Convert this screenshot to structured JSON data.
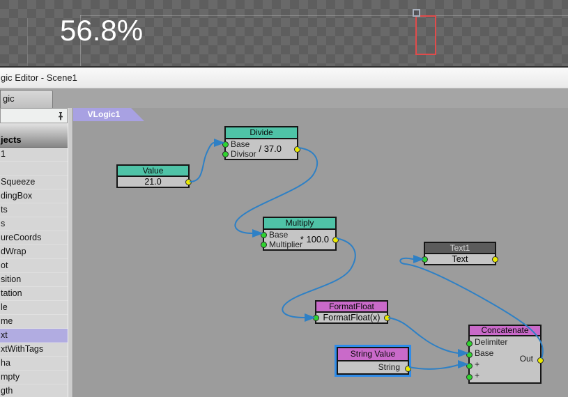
{
  "overlay": {
    "percentage": "56.8%",
    "marquee_color": "#e14b4b"
  },
  "window": {
    "title": "gic Editor - Scene1"
  },
  "doc_tabs": {
    "tabs": [
      {
        "label": "gic"
      }
    ]
  },
  "sidebar": {
    "pin_icon": "pin-icon",
    "header": "jects",
    "items": [
      "1",
      "",
      "Squeeze",
      "dingBox",
      "ts",
      "s",
      "ureCoords",
      "dWrap",
      "ot",
      "sition",
      "tation",
      "le",
      "me",
      "xt",
      "xtWithTags",
      "ha",
      "mpty",
      "gth"
    ],
    "selected_item": "xt",
    "selected_index": 13,
    "selected_color": "#b1ace1"
  },
  "canvas": {
    "tab": "VLogic1",
    "nodes": {
      "value": {
        "title": "Value",
        "value": "21.0"
      },
      "divide": {
        "title": "Divide",
        "inputs": [
          "Base",
          "Divisor"
        ],
        "value": "/ 37.0"
      },
      "multiply": {
        "title": "Multiply",
        "inputs": [
          "Base",
          "Multiplier"
        ],
        "value": "* 100.0"
      },
      "text1": {
        "title": "Text1",
        "row": "Text"
      },
      "formatfloat": {
        "title": "FormatFloat",
        "row": "FormatFloat(x)"
      },
      "stringvalue": {
        "title": "String Value",
        "output": "String",
        "selected": true
      },
      "concatenate": {
        "title": "Concatenate",
        "inputs": [
          "Delimiter",
          "Base",
          "+",
          "+"
        ],
        "output": "Out"
      }
    },
    "wires": [
      {
        "from": "Value.out",
        "to": "Divide.Base"
      },
      {
        "from": "Divide.out",
        "to": "Multiply.Base"
      },
      {
        "from": "Multiply.out",
        "to": "FormatFloat.in"
      },
      {
        "from": "FormatFloat.out",
        "to": "Concatenate.Base"
      },
      {
        "from": "String Value.String",
        "to": "Concatenate.+"
      },
      {
        "from": "Concatenate.Out",
        "to": "Text1.Text"
      }
    ]
  },
  "colors": {
    "canvas_bg": "#9c9c9c",
    "node_body": "#c5c5c5",
    "header_teal": "#4fc3a7",
    "header_magenta": "#c96ac9",
    "header_dark": "#5b5b5b",
    "wire_blue": "#2e80c5",
    "port_in_green": "#2fd32f",
    "port_out_yellow": "#e9e900",
    "selection_blue": "#2f8ce9",
    "active_tab_lavender": "#a8a1e2"
  }
}
